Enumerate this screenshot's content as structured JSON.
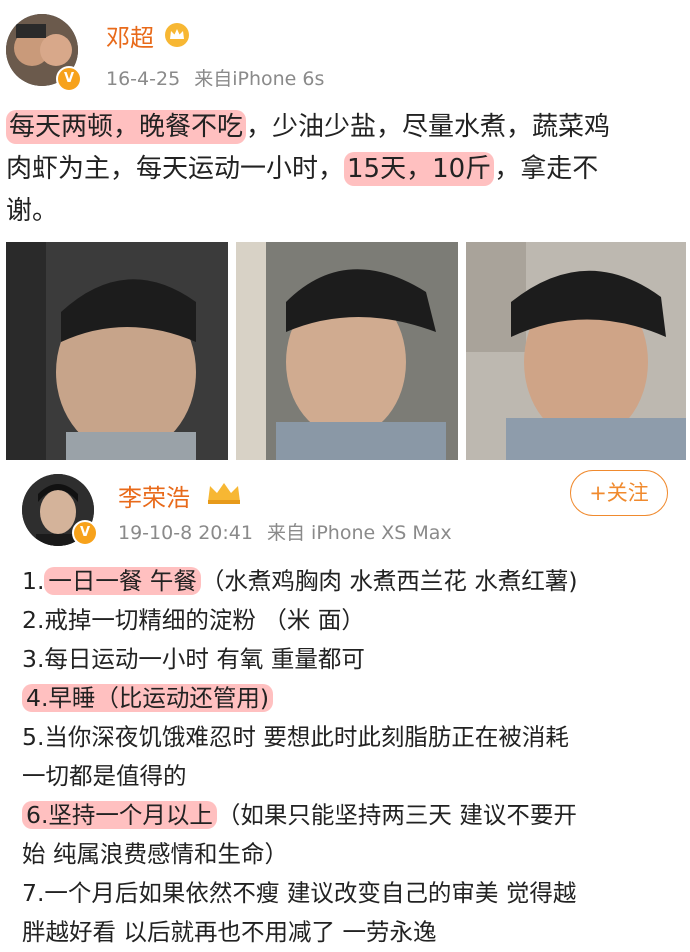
{
  "post1": {
    "username": "邓超",
    "timestamp": "16-4-25",
    "source": "来自iPhone 6s",
    "text": {
      "hl1": "每天两顿，晚餐不吃",
      "plain1": "，少油少盐，尽量水煮，蔬菜鸡",
      "plain2": "肉虾为主，每天运动一小时，",
      "hl2": "15天，10斤",
      "plain3": "，拿走不",
      "plain4": "谢。"
    },
    "photos": [
      "photo-1",
      "photo-2",
      "photo-3"
    ]
  },
  "post2": {
    "username": "李荣浩",
    "timestamp": "19-10-8 20:41",
    "source": "来自 iPhone XS Max",
    "follow_label": "+关注",
    "lines": {
      "l1_num": "1.",
      "l1_hl": "一日一餐 午餐",
      "l1_rest": "（水煮鸡胸肉 水煮西兰花 水煮红薯)",
      "l2": "2.戒掉一切精细的淀粉 （米 面）",
      "l3": "3.每日运动一小时 有氧 重量都可",
      "l4_hl": "4.早睡（比运动还管用)",
      "l5a": "5.当你深夜饥饿难忍时 要想此时此刻脂肪正在被消耗",
      "l5b": "一切都是值得的",
      "l6_hl": "6.坚持一个月以上",
      "l6_rest": "（如果只能坚持两三天 建议不要开",
      "l6b": "始 纯属浪费感情和生命）",
      "l7a": "7.一个月后如果依然不瘦 建议改变自己的审美 觉得越",
      "l7b": "胖越好看 以后就再也不用减了 一劳永逸"
    }
  },
  "colors": {
    "username": "#e86a1a",
    "highlight": "#ff8c8c",
    "follow": "#f08a2e",
    "vip_badge": "#f7a21b"
  },
  "icons": [
    "crown-icon",
    "verified-badge-icon",
    "plus-icon"
  ]
}
